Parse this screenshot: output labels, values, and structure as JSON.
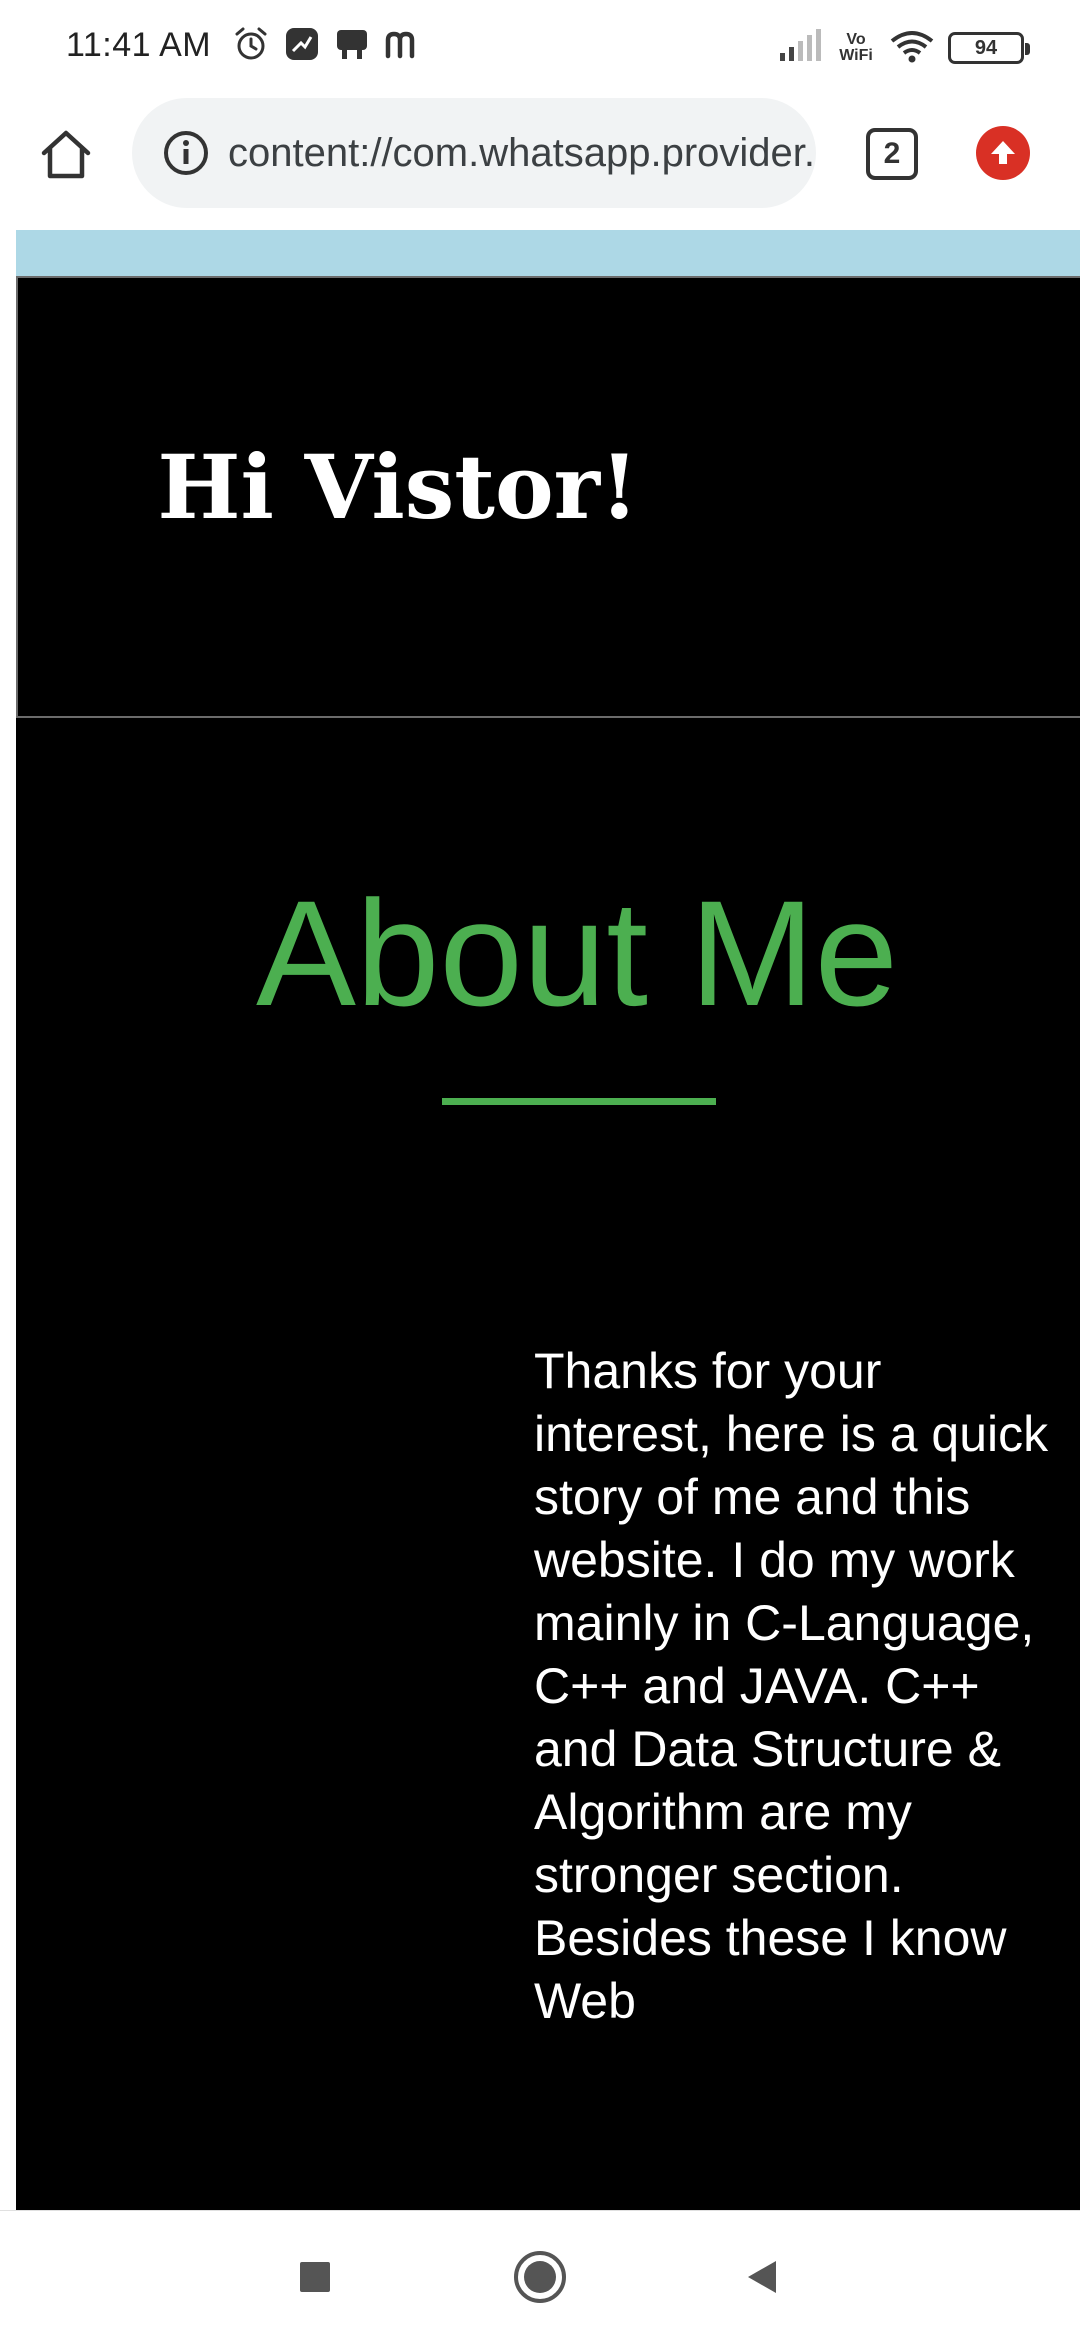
{
  "status_bar": {
    "time": "11:41 AM",
    "left_icons": [
      "alarm-icon",
      "stocks-app-icon",
      "notification-app-icon",
      "m-app-icon"
    ],
    "vowifi_line1": "Vo",
    "vowifi_line2": "WiFi",
    "battery": "94"
  },
  "browser": {
    "url": "content://com.whatsapp.provider.media/item/",
    "tab_count": "2",
    "update_color": "#d93025"
  },
  "page": {
    "hero_title": "Hi Vistor!",
    "about_title": "About Me",
    "about_text": "Thanks for your interest, here is a quick story of me and this website. I do my work mainly in C-Language, C++ and JAVA. C++ and Data Structure & Algorithm are my stronger section. Besides these I know Web",
    "accent_color": "#4caf50",
    "stripe_color": "#add8e6"
  },
  "nav": {
    "buttons": [
      "recents-button",
      "home-button",
      "back-button"
    ]
  }
}
